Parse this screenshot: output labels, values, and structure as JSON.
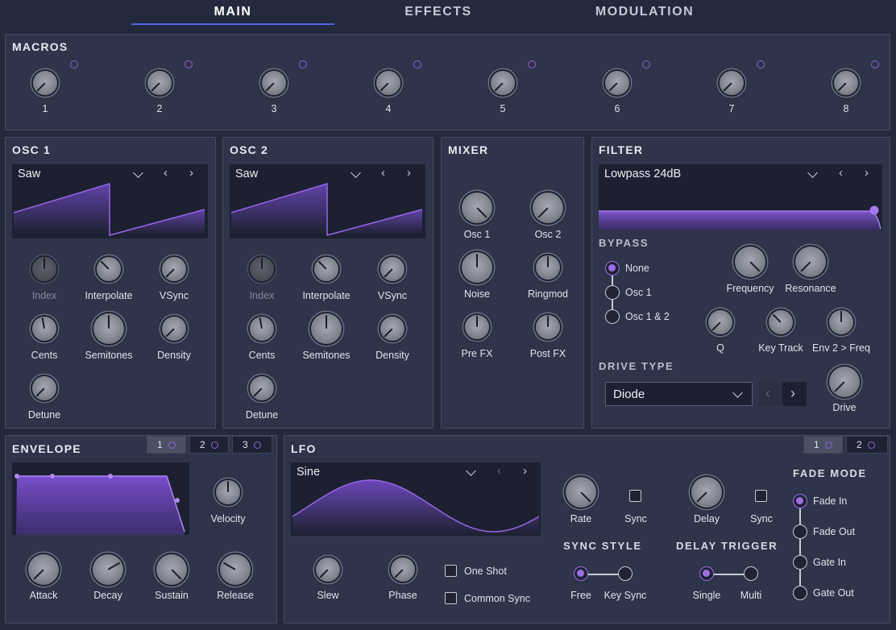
{
  "tabs": [
    {
      "label": "MAIN",
      "active": true
    },
    {
      "label": "EFFECTS",
      "active": false
    },
    {
      "label": "MODULATION",
      "active": false
    }
  ],
  "accent": "#9b6ee6",
  "macros": {
    "title": "MACROS",
    "labels": [
      "1",
      "2",
      "3",
      "4",
      "5",
      "6",
      "7",
      "8"
    ]
  },
  "osc1": {
    "title": "OSC 1",
    "waveform": "Saw",
    "knobs": {
      "index": "Index",
      "interpolate": "Interpolate",
      "vsync": "VSync",
      "cents": "Cents",
      "semitones": "Semitones",
      "density": "Density",
      "detune": "Detune"
    }
  },
  "osc2": {
    "title": "OSC 2",
    "waveform": "Saw",
    "knobs": {
      "index": "Index",
      "interpolate": "Interpolate",
      "vsync": "VSync",
      "cents": "Cents",
      "semitones": "Semitones",
      "density": "Density",
      "detune": "Detune"
    }
  },
  "mixer": {
    "title": "MIXER",
    "knobs": {
      "osc1": "Osc 1",
      "osc2": "Osc 2",
      "noise": "Noise",
      "ringmod": "Ringmod",
      "prefx": "Pre FX",
      "postfx": "Post FX"
    }
  },
  "filter": {
    "title": "FILTER",
    "type": "Lowpass 24dB",
    "bypass_label": "BYPASS",
    "bypass_options": [
      "None",
      "Osc 1",
      "Osc 1 & 2"
    ],
    "bypass_selected": "None",
    "knobs": {
      "frequency": "Frequency",
      "resonance": "Resonance",
      "q": "Q",
      "keytrack": "Key Track",
      "env2freq": "Env 2 > Freq",
      "drive": "Drive"
    },
    "drive_type_label": "DRIVE TYPE",
    "drive_type": "Diode"
  },
  "envelope": {
    "title": "ENVELOPE",
    "tabs": [
      "1",
      "2",
      "3"
    ],
    "active_tab": "1",
    "knobs": {
      "velocity": "Velocity",
      "attack": "Attack",
      "decay": "Decay",
      "sustain": "Sustain",
      "release": "Release"
    }
  },
  "lfo": {
    "title": "LFO",
    "tabs": [
      "1",
      "2"
    ],
    "active_tab": "1",
    "waveform": "Sine",
    "knobs": {
      "slew": "Slew",
      "phase": "Phase",
      "rate": "Rate",
      "delay": "Delay"
    },
    "rate_sync_label": "Sync",
    "delay_sync_label": "Sync",
    "one_shot": "One Shot",
    "common_sync": "Common Sync",
    "sync_style_label": "SYNC STYLE",
    "sync_style_options": [
      "Free",
      "Key Sync"
    ],
    "sync_style_selected": "Free",
    "delay_trigger_label": "DELAY TRIGGER",
    "delay_trigger_options": [
      "Single",
      "Multi"
    ],
    "delay_trigger_selected": "Single",
    "fade_mode_label": "FADE MODE",
    "fade_mode_options": [
      "Fade In",
      "Fade Out",
      "Gate In",
      "Gate Out"
    ],
    "fade_mode_selected": "Fade In"
  }
}
